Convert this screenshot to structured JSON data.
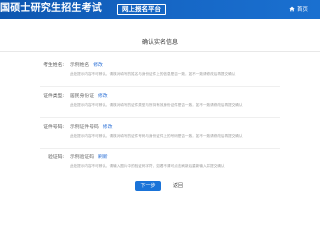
{
  "header": {
    "title": "国硕士研究生招生考试",
    "badge": "网上报名平台",
    "home_label": "首页"
  },
  "main": {
    "title": "确认实名信息",
    "rows": [
      {
        "label": "考生姓名:",
        "value": "示例姓名",
        "edit": "修改",
        "hint": "此处提示内容不可辨认，请核对填写的姓名与身份证件上的信息是否一致，如不一致请修改后再提交确认"
      },
      {
        "label": "证件类型:",
        "value": "居民身份证",
        "edit": "修改",
        "hint": "此处提示内容不可辨认，请核对填写的证件类型与所持有效身份证件是否一致，如不一致请修改后再提交确认"
      },
      {
        "label": "证件号码:",
        "value": "示例证件号码",
        "edit": "修改",
        "hint": "此处提示内容不可辨认，请核对填写的证件号码与身份证件上的号码是否一致，如不一致请修改后再提交确认"
      },
      {
        "label": "验证码:",
        "value": "示例验证码",
        "edit": "刷新",
        "hint": "此处提示内容不可辨认，请输入图片中的验证码字符，如看不清可点击刷新后重新输入并提交确认"
      }
    ],
    "next_label": "下一步",
    "back_label": "返回"
  }
}
